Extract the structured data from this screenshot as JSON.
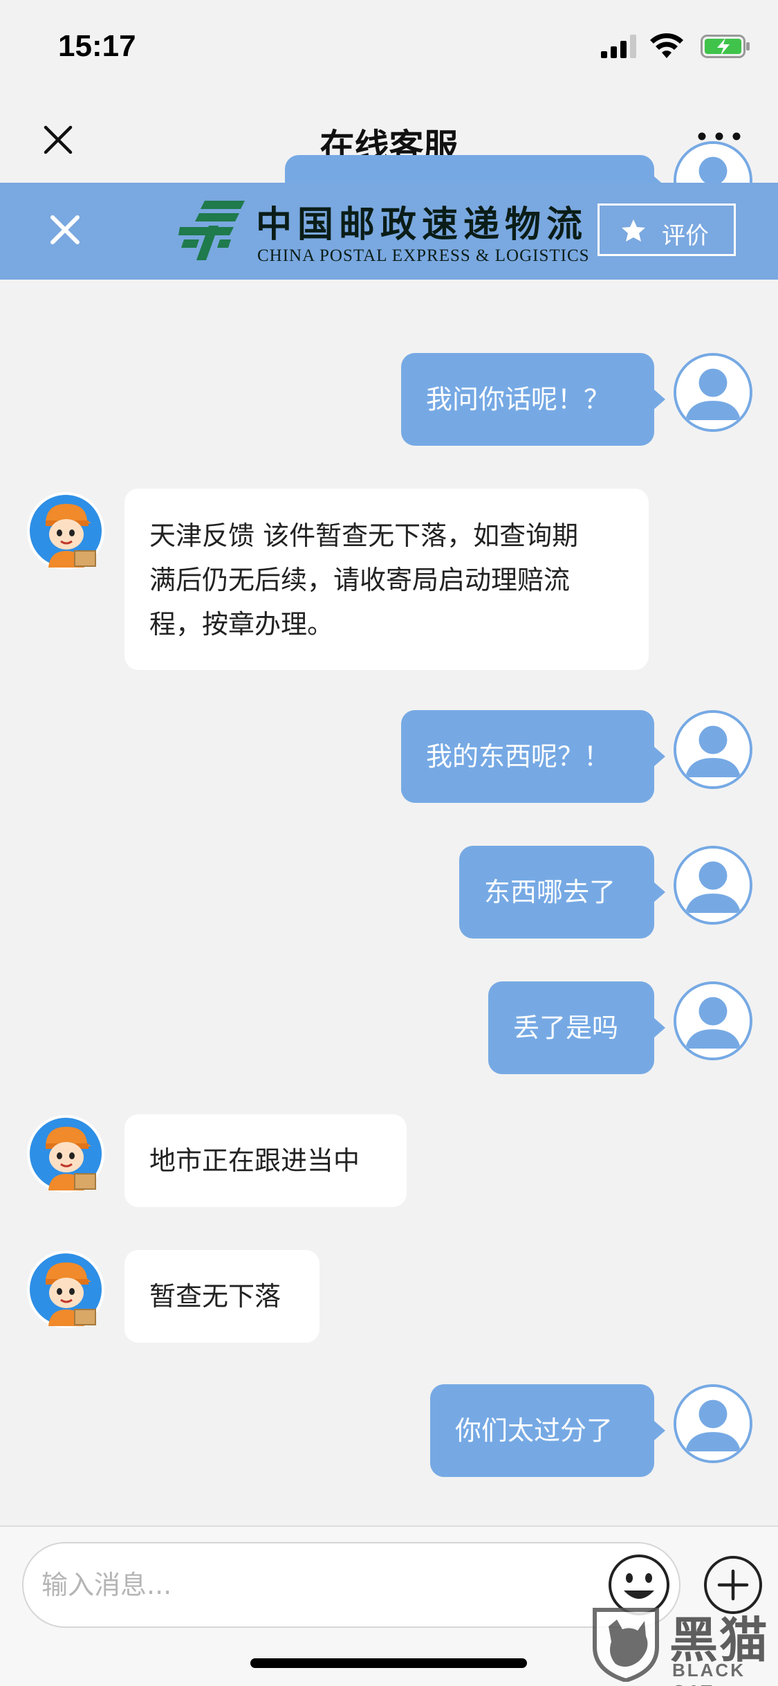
{
  "status_bar": {
    "time": "15:17"
  },
  "nav": {
    "title": "在线客服"
  },
  "banner": {
    "logo_cn": "中国邮政速递物流",
    "logo_en": "CHINA POSTAL EXPRESS & LOGISTICS",
    "rate_label": "评价"
  },
  "messages": [
    {
      "sender": "user",
      "lines": [
        ""
      ]
    },
    {
      "sender": "user",
      "lines": [
        "我问你话呢！？"
      ]
    },
    {
      "sender": "agent",
      "lines": [
        "天津反馈 该件暂查无下落，如查询期",
        "满后仍无后续，请收寄局启动理赔流",
        "程，按章办理。"
      ]
    },
    {
      "sender": "user",
      "lines": [
        "我的东西呢？！"
      ]
    },
    {
      "sender": "user",
      "lines": [
        "东西哪去了"
      ]
    },
    {
      "sender": "user",
      "lines": [
        "丢了是吗"
      ]
    },
    {
      "sender": "agent",
      "lines": [
        "地市正在跟进当中"
      ]
    },
    {
      "sender": "agent",
      "lines": [
        "暂查无下落"
      ]
    },
    {
      "sender": "user",
      "lines": [
        "你们太过分了"
      ]
    }
  ],
  "input": {
    "placeholder": "输入消息..."
  },
  "watermark": {
    "cn": "黑猫",
    "en": "BLACK CAT"
  },
  "colors": {
    "accent": "#76a9e4",
    "banner": "#7aa8e0",
    "logo_green": "#1f7a4c"
  }
}
